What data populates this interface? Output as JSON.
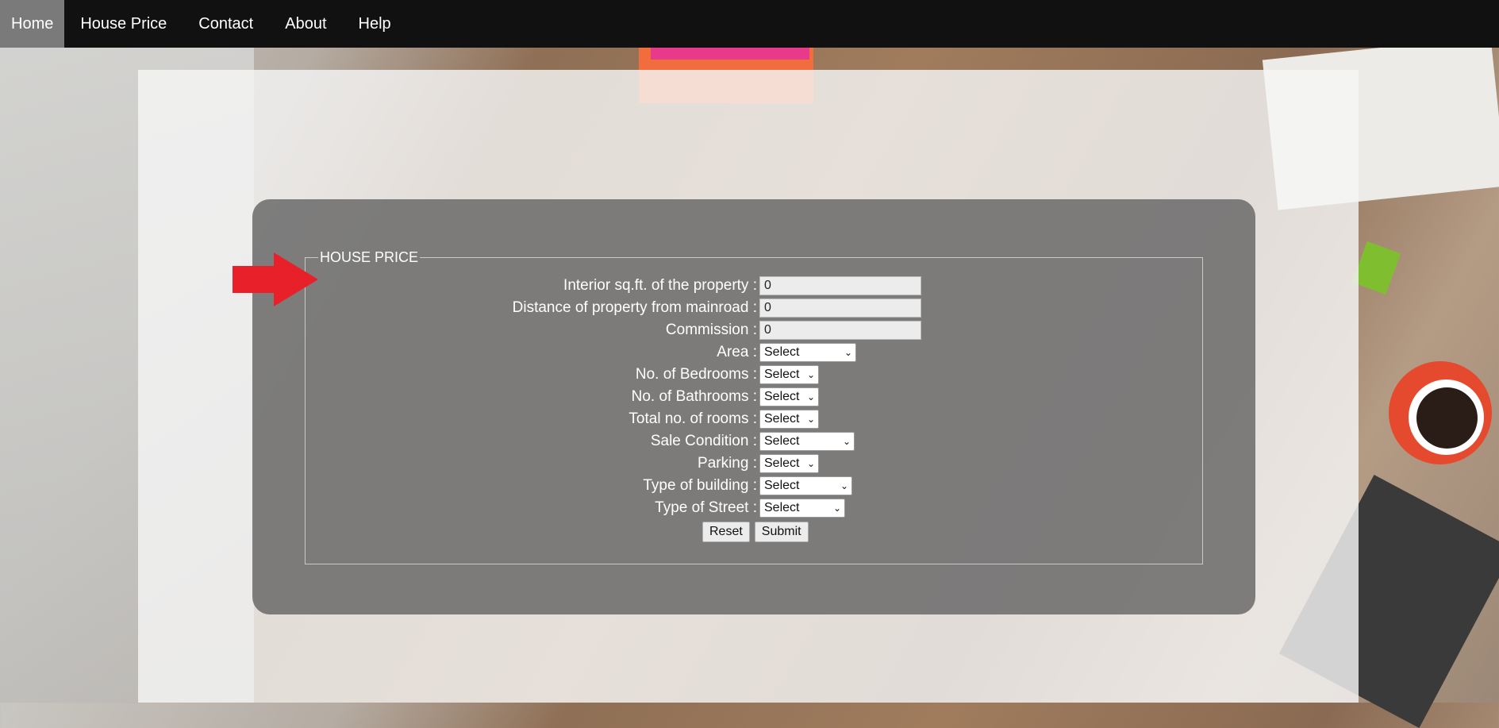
{
  "nav": {
    "items": [
      {
        "label": "Home",
        "active": true
      },
      {
        "label": "House Price",
        "active": false
      },
      {
        "label": "Contact",
        "active": false
      },
      {
        "label": "About",
        "active": false
      },
      {
        "label": "Help",
        "active": false
      }
    ]
  },
  "form": {
    "legend": "HOUSE PRICE",
    "fields": {
      "interior_sqft": {
        "label": "Interior sq.ft. of the property :",
        "value": "0"
      },
      "distance_mainroad": {
        "label": "Distance of property from mainroad :",
        "value": "0"
      },
      "commission": {
        "label": "Commission :",
        "value": "0"
      },
      "area": {
        "label": "Area :",
        "selected": "Select"
      },
      "bedrooms": {
        "label": "No. of Bedrooms :",
        "selected": "Select"
      },
      "bathrooms": {
        "label": "No. of Bathrooms :",
        "selected": "Select"
      },
      "total_rooms": {
        "label": "Total no. of rooms :",
        "selected": "Select"
      },
      "sale_condition": {
        "label": "Sale Condition :",
        "selected": "Select"
      },
      "parking": {
        "label": "Parking :",
        "selected": "Select"
      },
      "building_type": {
        "label": "Type of building :",
        "selected": "Select"
      },
      "street_type": {
        "label": "Type of Street :",
        "selected": "Select"
      }
    },
    "buttons": {
      "reset": "Reset",
      "submit": "Submit"
    }
  },
  "colors": {
    "navbar": "#111111",
    "nav_active": "#7a7a7a",
    "arrow": "#e8202a"
  },
  "icons": {
    "pointer": "red-arrow-icon",
    "dropdown": "chevron-down-icon"
  }
}
